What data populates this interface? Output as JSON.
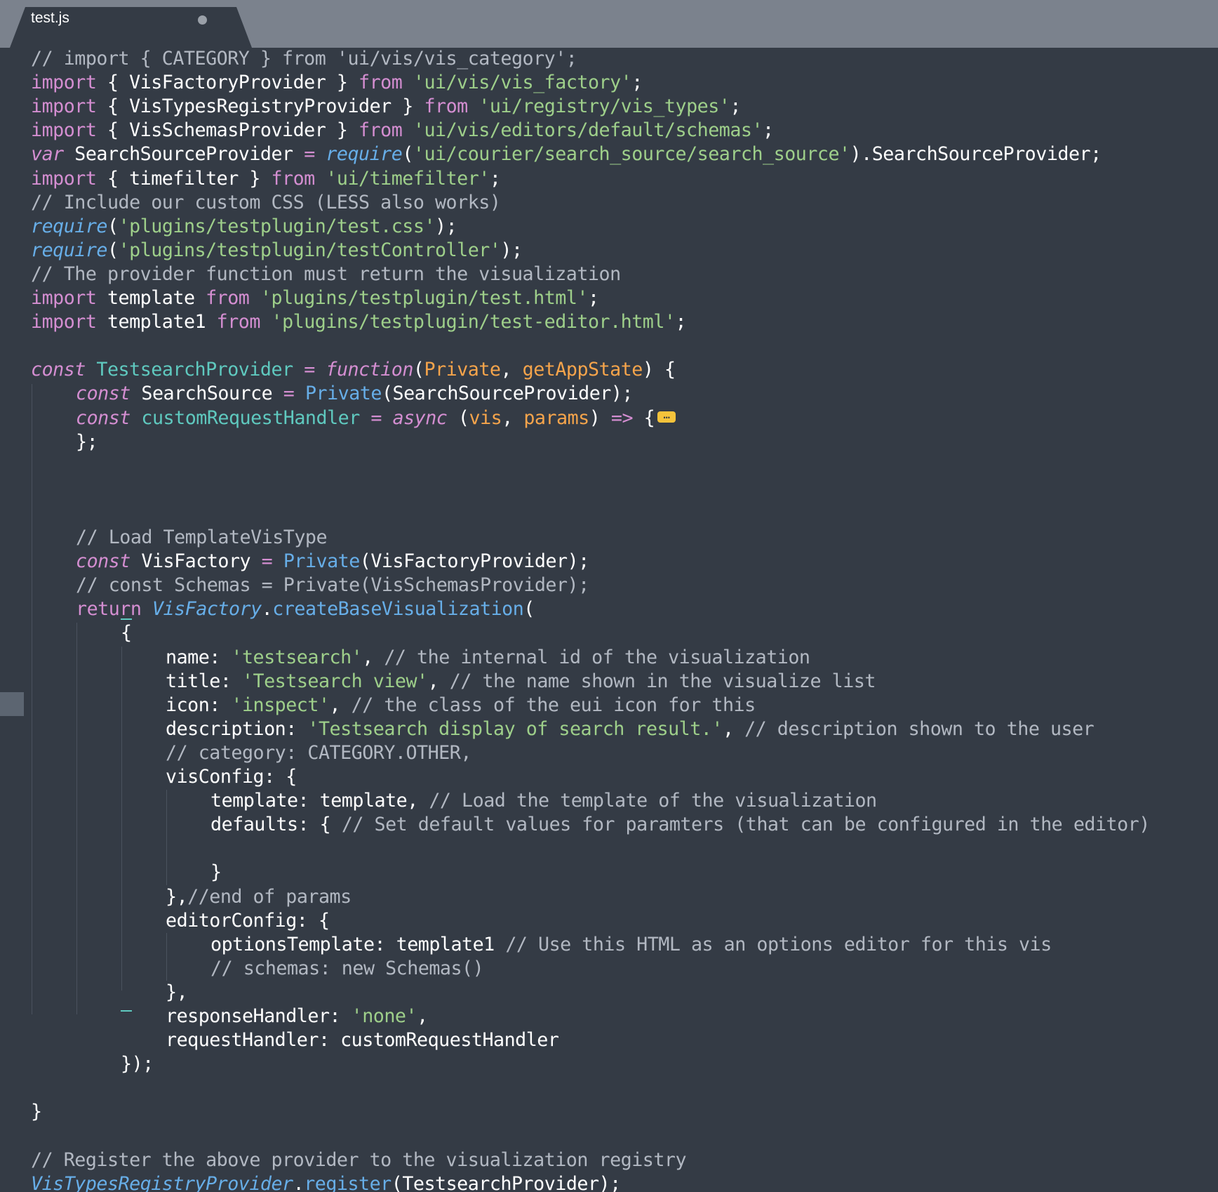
{
  "tab": {
    "title": "test.js"
  },
  "code": {
    "lines": [
      {
        "indent": 0,
        "tokens": [
          {
            "t": "// import { CATEGORY } from 'ui/vis/vis_category';",
            "c": "cm"
          }
        ]
      },
      {
        "indent": 0,
        "tokens": [
          {
            "t": "import",
            "c": "k"
          },
          {
            "t": " { VisFactoryProvider } ",
            "c": "pl"
          },
          {
            "t": "from",
            "c": "k"
          },
          {
            "t": " 'ui/vis/vis_factory'",
            "c": "str"
          },
          {
            "t": ";",
            "c": "pl"
          }
        ]
      },
      {
        "indent": 0,
        "tokens": [
          {
            "t": "import",
            "c": "k"
          },
          {
            "t": " { VisTypesRegistryProvider } ",
            "c": "pl"
          },
          {
            "t": "from",
            "c": "k"
          },
          {
            "t": " 'ui/registry/vis_types'",
            "c": "str"
          },
          {
            "t": ";",
            "c": "pl"
          }
        ]
      },
      {
        "indent": 0,
        "tokens": [
          {
            "t": "import",
            "c": "k"
          },
          {
            "t": " { VisSchemasProvider } ",
            "c": "pl"
          },
          {
            "t": "from",
            "c": "k"
          },
          {
            "t": " 'ui/vis/editors/default/schemas'",
            "c": "str"
          },
          {
            "t": ";",
            "c": "pl"
          }
        ]
      },
      {
        "indent": 0,
        "tokens": [
          {
            "t": "var",
            "c": "ki"
          },
          {
            "t": " SearchSourceProvider ",
            "c": "pl"
          },
          {
            "t": "=",
            "c": "op"
          },
          {
            "t": " ",
            "c": "pl"
          },
          {
            "t": "require",
            "c": "fni"
          },
          {
            "t": "(",
            "c": "pl"
          },
          {
            "t": "'ui/courier/search_source/search_source'",
            "c": "str"
          },
          {
            "t": ").SearchSourceProvider;",
            "c": "pl"
          }
        ]
      },
      {
        "indent": 0,
        "tokens": [
          {
            "t": "import",
            "c": "k"
          },
          {
            "t": " { timefilter } ",
            "c": "pl"
          },
          {
            "t": "from",
            "c": "k"
          },
          {
            "t": " 'ui/timefilter'",
            "c": "str"
          },
          {
            "t": ";",
            "c": "pl"
          }
        ]
      },
      {
        "indent": 0,
        "tokens": [
          {
            "t": "// Include our custom CSS (LESS also works)",
            "c": "cm"
          }
        ]
      },
      {
        "indent": 0,
        "tokens": [
          {
            "t": "require",
            "c": "fni"
          },
          {
            "t": "(",
            "c": "pl"
          },
          {
            "t": "'plugins/testplugin/test.css'",
            "c": "str"
          },
          {
            "t": ");",
            "c": "pl"
          }
        ]
      },
      {
        "indent": 0,
        "tokens": [
          {
            "t": "require",
            "c": "fni"
          },
          {
            "t": "(",
            "c": "pl"
          },
          {
            "t": "'plugins/testplugin/testController'",
            "c": "str"
          },
          {
            "t": ");",
            "c": "pl"
          }
        ]
      },
      {
        "indent": 0,
        "tokens": [
          {
            "t": "// The provider function must return the visualization",
            "c": "cm"
          }
        ]
      },
      {
        "indent": 0,
        "tokens": [
          {
            "t": "import",
            "c": "k"
          },
          {
            "t": " template ",
            "c": "pl"
          },
          {
            "t": "from",
            "c": "k"
          },
          {
            "t": " 'plugins/testplugin/test.html'",
            "c": "str"
          },
          {
            "t": ";",
            "c": "pl"
          }
        ]
      },
      {
        "indent": 0,
        "tokens": [
          {
            "t": "import",
            "c": "k"
          },
          {
            "t": " template1 ",
            "c": "pl"
          },
          {
            "t": "from",
            "c": "k"
          },
          {
            "t": " 'plugins/testplugin/test-editor.html'",
            "c": "str"
          },
          {
            "t": ";",
            "c": "pl"
          }
        ]
      },
      {
        "indent": 0,
        "tokens": []
      },
      {
        "indent": 0,
        "tokens": [
          {
            "t": "const",
            "c": "ki"
          },
          {
            "t": " ",
            "c": "pl"
          },
          {
            "t": "TestsearchProvider",
            "c": "def"
          },
          {
            "t": " ",
            "c": "pl"
          },
          {
            "t": "=",
            "c": "op"
          },
          {
            "t": " ",
            "c": "pl"
          },
          {
            "t": "function",
            "c": "ki"
          },
          {
            "t": "(",
            "c": "pl"
          },
          {
            "t": "Private",
            "c": "par"
          },
          {
            "t": ", ",
            "c": "pl"
          },
          {
            "t": "getAppState",
            "c": "par"
          },
          {
            "t": ") {",
            "c": "pl"
          }
        ]
      },
      {
        "indent": 1,
        "tokens": [
          {
            "t": "const",
            "c": "ki"
          },
          {
            "t": " SearchSource ",
            "c": "pl"
          },
          {
            "t": "=",
            "c": "op"
          },
          {
            "t": " ",
            "c": "pl"
          },
          {
            "t": "Private",
            "c": "fn"
          },
          {
            "t": "(SearchSourceProvider);",
            "c": "pl"
          }
        ]
      },
      {
        "indent": 1,
        "fold": true,
        "tokens": [
          {
            "t": "const",
            "c": "ki"
          },
          {
            "t": " ",
            "c": "pl"
          },
          {
            "t": "customRequestHandler",
            "c": "def"
          },
          {
            "t": " ",
            "c": "pl"
          },
          {
            "t": "=",
            "c": "op"
          },
          {
            "t": " ",
            "c": "pl"
          },
          {
            "t": "async",
            "c": "ki"
          },
          {
            "t": " (",
            "c": "pl"
          },
          {
            "t": "vis",
            "c": "par"
          },
          {
            "t": ", ",
            "c": "pl"
          },
          {
            "t": "params",
            "c": "par"
          },
          {
            "t": ") ",
            "c": "pl"
          },
          {
            "t": "=>",
            "c": "op"
          },
          {
            "t": " {",
            "c": "pl"
          }
        ]
      },
      {
        "indent": 1,
        "tokens": [
          {
            "t": "};",
            "c": "pl"
          }
        ]
      },
      {
        "indent": 0,
        "tokens": []
      },
      {
        "indent": 0,
        "tokens": []
      },
      {
        "indent": 0,
        "tokens": []
      },
      {
        "indent": 1,
        "tokens": [
          {
            "t": "// Load TemplateVisType",
            "c": "cm"
          }
        ]
      },
      {
        "indent": 1,
        "tokens": [
          {
            "t": "const",
            "c": "ki"
          },
          {
            "t": " VisFactory ",
            "c": "pl"
          },
          {
            "t": "=",
            "c": "op"
          },
          {
            "t": " ",
            "c": "pl"
          },
          {
            "t": "Private",
            "c": "fn"
          },
          {
            "t": "(VisFactoryProvider);",
            "c": "pl"
          }
        ]
      },
      {
        "indent": 1,
        "tokens": [
          {
            "t": "// const Schemas = Private(VisSchemasProvider);",
            "c": "cm"
          }
        ]
      },
      {
        "indent": 1,
        "tokens": [
          {
            "t": "return",
            "c": "k"
          },
          {
            "t": " ",
            "c": "pl"
          },
          {
            "t": "VisFactory",
            "c": "fni"
          },
          {
            "t": ".",
            "c": "pl"
          },
          {
            "t": "createBaseVisualization",
            "c": "fn"
          },
          {
            "t": "(",
            "c": "pl"
          }
        ]
      },
      {
        "indent": 2,
        "tokens": [
          {
            "t": "{",
            "c": "pl"
          }
        ]
      },
      {
        "indent": 3,
        "tokens": [
          {
            "t": "name: ",
            "c": "pl"
          },
          {
            "t": "'testsearch'",
            "c": "str"
          },
          {
            "t": ", ",
            "c": "pl"
          },
          {
            "t": "// the internal id of the visualization",
            "c": "cm"
          }
        ]
      },
      {
        "indent": 3,
        "tokens": [
          {
            "t": "title: ",
            "c": "pl"
          },
          {
            "t": "'Testsearch view'",
            "c": "str"
          },
          {
            "t": ", ",
            "c": "pl"
          },
          {
            "t": "// the name shown in the visualize list",
            "c": "cm"
          }
        ]
      },
      {
        "indent": 3,
        "tokens": [
          {
            "t": "icon: ",
            "c": "pl"
          },
          {
            "t": "'inspect'",
            "c": "str"
          },
          {
            "t": ", ",
            "c": "pl"
          },
          {
            "t": "// the class of the eui icon for this",
            "c": "cm"
          }
        ]
      },
      {
        "indent": 3,
        "tokens": [
          {
            "t": "description: ",
            "c": "pl"
          },
          {
            "t": "'Testsearch display of search result.'",
            "c": "str"
          },
          {
            "t": ", ",
            "c": "pl"
          },
          {
            "t": "// description shown to the user",
            "c": "cm"
          }
        ]
      },
      {
        "indent": 3,
        "tokens": [
          {
            "t": "// category: CATEGORY.OTHER,",
            "c": "cm"
          }
        ]
      },
      {
        "indent": 3,
        "tokens": [
          {
            "t": "visConfig: {",
            "c": "pl"
          }
        ]
      },
      {
        "indent": 4,
        "tokens": [
          {
            "t": "template: template, ",
            "c": "pl"
          },
          {
            "t": "// Load the template of the visualization",
            "c": "cm"
          }
        ]
      },
      {
        "indent": 4,
        "tokens": [
          {
            "t": "defaults: { ",
            "c": "pl"
          },
          {
            "t": "// Set default values for paramters (that can be configured in the editor)",
            "c": "cm"
          }
        ]
      },
      {
        "indent": 0,
        "tokens": []
      },
      {
        "indent": 4,
        "tokens": [
          {
            "t": "}",
            "c": "pl"
          }
        ]
      },
      {
        "indent": 3,
        "tokens": [
          {
            "t": "},",
            "c": "pl"
          },
          {
            "t": "//end of params",
            "c": "cm"
          }
        ]
      },
      {
        "indent": 3,
        "tokens": [
          {
            "t": "editorConfig: {",
            "c": "pl"
          }
        ]
      },
      {
        "indent": 4,
        "tokens": [
          {
            "t": "optionsTemplate: template1 ",
            "c": "pl"
          },
          {
            "t": "// Use this HTML as an options editor for this vis",
            "c": "cm"
          }
        ]
      },
      {
        "indent": 4,
        "tokens": [
          {
            "t": "// schemas: new Schemas()",
            "c": "cm"
          }
        ]
      },
      {
        "indent": 3,
        "tokens": [
          {
            "t": "},",
            "c": "pl"
          }
        ]
      },
      {
        "indent": 3,
        "tokens": [
          {
            "t": "responseHandler: ",
            "c": "pl"
          },
          {
            "t": "'none'",
            "c": "str"
          },
          {
            "t": ",",
            "c": "pl"
          }
        ]
      },
      {
        "indent": 3,
        "tokens": [
          {
            "t": "requestHandler: customRequestHandler",
            "c": "pl"
          }
        ]
      },
      {
        "indent": 2,
        "tokens": [
          {
            "t": "});",
            "c": "pl"
          }
        ]
      },
      {
        "indent": 0,
        "tokens": []
      },
      {
        "indent": 0,
        "tokens": [
          {
            "t": "}",
            "c": "pl"
          }
        ]
      },
      {
        "indent": 0,
        "tokens": []
      },
      {
        "indent": 0,
        "tokens": [
          {
            "t": "// Register the above provider to the visualization registry",
            "c": "cm"
          }
        ]
      },
      {
        "indent": 0,
        "tokens": [
          {
            "t": "VisTypesRegistryProvider",
            "c": "fni"
          },
          {
            "t": ".",
            "c": "pl"
          },
          {
            "t": "register",
            "c": "fn"
          },
          {
            "t": "(TestsearchProvider);",
            "c": "pl"
          }
        ]
      }
    ]
  },
  "colors": {
    "background": "#343b45",
    "tabbar": "#7b828d",
    "keyword": "#d48ed1",
    "string": "#9ecf8a",
    "comment": "#b2b8c2",
    "function": "#67aee8",
    "definition": "#5fc9bf",
    "parameter": "#f5a44b",
    "fold_marker": "#f5c33b"
  },
  "icons": {
    "tab_modified": "unsaved-dot-icon",
    "fold": "folded-code-ellipsis-icon"
  }
}
